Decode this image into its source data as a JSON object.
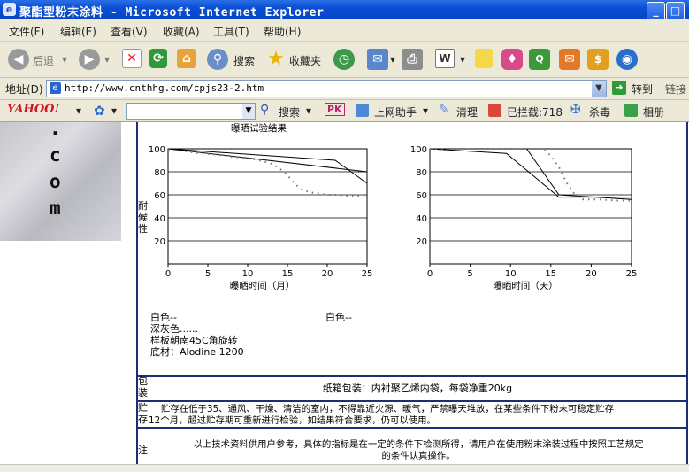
{
  "window": {
    "title": "聚酯型粉末涂料 - Microsoft Internet Explorer"
  },
  "menu": {
    "items": [
      "文件(F)",
      "编辑(E)",
      "查看(V)",
      "收藏(A)",
      "工具(T)",
      "帮助(H)"
    ]
  },
  "toolbar": {
    "back_label": "后退",
    "search_label": "搜索",
    "favorites_label": "收藏夹"
  },
  "address": {
    "label": "地址(D)",
    "url": "http://www.cnthhg.com/cpjs23-2.htm",
    "go_label": "转到",
    "links_label": "链接"
  },
  "yahoo": {
    "logo": "YAHOO!",
    "search_label": "搜索",
    "pk_label": "PK",
    "assistant_label": "上网助手",
    "clean_label": "清理",
    "blocked_label": "已拦截:718",
    "antivirus_label": "杀毒",
    "album_label": "相册"
  },
  "left_logo": {
    "letters": [
      ".",
      "c",
      "o",
      "m"
    ]
  },
  "rows": {
    "weather_label": [
      "耐",
      "候",
      "性"
    ],
    "packaging_label": [
      "包",
      "装"
    ],
    "storage_label": [
      "贮",
      "存"
    ],
    "note_label": "注"
  },
  "chart_data": [
    {
      "type": "line",
      "title": "曝晒试验结果",
      "xlabel": "曝晒时间（月）",
      "ylabel": "",
      "x_ticks": [
        0,
        5,
        10,
        15,
        20,
        25
      ],
      "y_ticks": [
        20,
        40,
        60,
        80,
        100
      ],
      "xlim": [
        0,
        25
      ],
      "ylim": [
        0,
        100
      ],
      "grid": true,
      "series": [
        {
          "style": "solid",
          "x": [
            0,
            21,
            25
          ],
          "y": [
            100,
            90,
            70
          ]
        },
        {
          "style": "solid",
          "x": [
            0,
            25
          ],
          "y": [
            100,
            80
          ]
        },
        {
          "style": "dotted",
          "x": [
            0,
            2,
            4,
            6,
            8,
            10,
            12,
            13,
            14,
            15,
            16,
            17,
            18,
            19,
            20,
            21,
            22,
            23,
            24,
            25
          ],
          "y": [
            99,
            98,
            96,
            95,
            93,
            92,
            89,
            87,
            83,
            77,
            69,
            64,
            62,
            61,
            60,
            60,
            59,
            59,
            59,
            58
          ]
        }
      ]
    },
    {
      "type": "line",
      "title": "",
      "xlabel": "曝晒时间（天）",
      "ylabel": "",
      "x_ticks": [
        0,
        5,
        10,
        15,
        20,
        25
      ],
      "y_ticks": [
        20,
        40,
        60,
        80,
        100
      ],
      "xlim": [
        0,
        25
      ],
      "ylim": [
        0,
        100
      ],
      "grid": true,
      "series": [
        {
          "style": "solid",
          "x": [
            0,
            9.5,
            16,
            25
          ],
          "y": [
            100,
            96,
            58,
            58
          ]
        },
        {
          "style": "solid",
          "x": [
            0,
            12,
            16,
            25
          ],
          "y": [
            100,
            100,
            60,
            56
          ]
        },
        {
          "style": "dotted",
          "x": [
            0,
            14,
            15,
            16,
            17,
            18,
            19,
            21,
            23,
            25
          ],
          "y": [
            100,
            100,
            94,
            84,
            70,
            60,
            56,
            56,
            55,
            55
          ]
        }
      ]
    }
  ],
  "chart_legend": {
    "left_lines": [
      "白色--",
      "深灰色......",
      "样板朝南45C角旋转",
      "底材：Alodine 1200"
    ],
    "right_white": "白色--"
  },
  "packaging_text": "纸箱包装：内衬聚乙烯内袋，每袋净重20kg",
  "storage_text_1": "贮存在低于35、通风、干燥、清洁的室内，不得靠近火源、暖气，严禁曝天堆放，在某些条件下粉末可稳定贮存",
  "storage_text_2": "12个月，超过贮存期可重新进行检验，如结果符合要求，仍可以使用。",
  "note_text_1": "以上技术资料供用户参考，具体的指标是在一定的条件下检测所得，请用户在使用粉末涂装过程中按照工艺规定",
  "note_text_2": "的条件认真操作。"
}
